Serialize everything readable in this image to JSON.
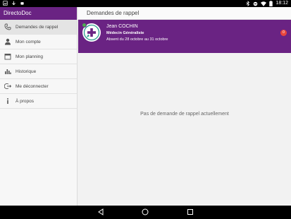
{
  "status_bar": {
    "time": "18:12"
  },
  "sidebar": {
    "app_title": "DirectoDoc",
    "items": [
      {
        "label": "Demandes de rappel",
        "icon": "phone-icon"
      },
      {
        "label": "Mon compte",
        "icon": "person-icon"
      },
      {
        "label": "Mon planning",
        "icon": "calendar-icon"
      },
      {
        "label": "Historique",
        "icon": "bar-chart-icon"
      },
      {
        "label": "Me déconnecter",
        "icon": "logout-icon"
      },
      {
        "label": "À propos",
        "icon": "info-icon"
      }
    ]
  },
  "main": {
    "title": "Demandes de rappel",
    "request": {
      "name": "Jean COCHIN",
      "specialty": "Médecin Généraliste",
      "absence": "Absent du 28 octobre au 31 octobre",
      "badge": "0"
    },
    "empty_message": "Pas de demande de rappel actuellement"
  },
  "colors": {
    "brand": "#6a2383",
    "online": "#4caf50",
    "badge": "#e8453c"
  }
}
